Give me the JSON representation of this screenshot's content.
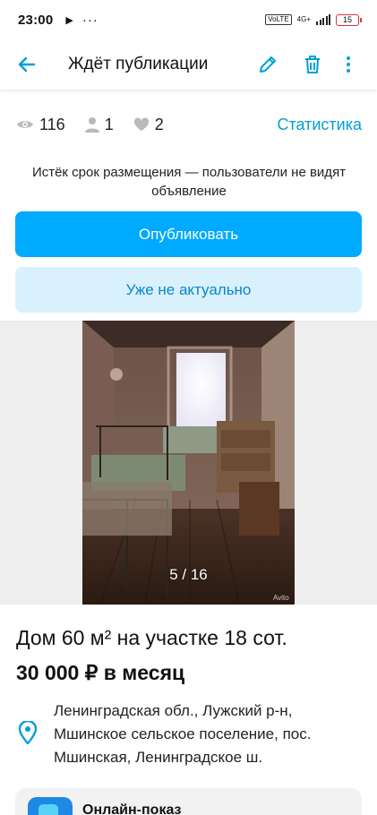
{
  "status_bar": {
    "time": "23:00",
    "badge": "VoLTE",
    "network": "4G+",
    "battery": "15"
  },
  "app_bar": {
    "title": "Ждёт публикации",
    "back_icon": "arrow-left-icon",
    "edit_icon": "pencil-icon",
    "delete_icon": "trash-icon",
    "more_icon": "more-vertical-icon"
  },
  "stats": {
    "views": "116",
    "contacts": "1",
    "favorites": "2",
    "statistics_link": "Статистика"
  },
  "notice": "Истёк срок размещения — пользователи не видят объявление",
  "buttons": {
    "publish": "Опубликовать",
    "not_relevant": "Уже не актуально"
  },
  "gallery": {
    "counter": "5 / 16",
    "watermark": "Avito"
  },
  "listing": {
    "title": "Дом 60 м² на участке 18 сот.",
    "price": "30 000 ₽ в месяц",
    "address": "Ленинградская обл., Лужский р-н, Мшинское сельское поселение, пос. Мшинская, Ленинградское ш."
  },
  "online_showing": {
    "title": "Онлайн-показ"
  },
  "colors": {
    "accent": "#00aaff",
    "link": "#00a0d6",
    "secondary_bg": "#d8f1fd",
    "secondary_text": "#0a86c8"
  }
}
